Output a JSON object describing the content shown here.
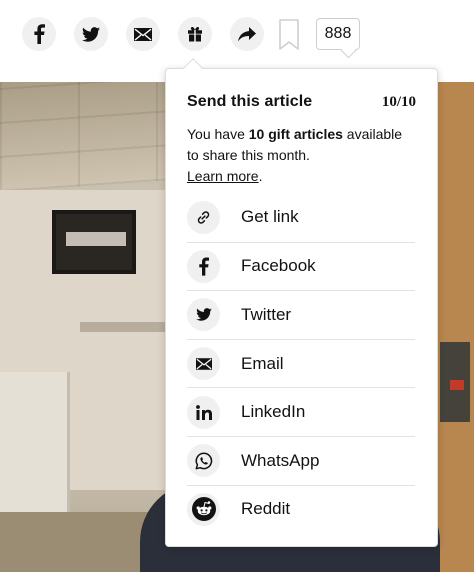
{
  "toolbar": {
    "comment_count": "888",
    "buttons": [
      {
        "name": "facebook-share-button",
        "icon": "facebook-icon"
      },
      {
        "name": "twitter-share-button",
        "icon": "twitter-icon"
      },
      {
        "name": "email-share-button",
        "icon": "mail-icon"
      },
      {
        "name": "gift-article-button",
        "icon": "gift-icon"
      },
      {
        "name": "more-share-button",
        "icon": "share-arrow-icon"
      }
    ],
    "bookmark_icon": "bookmark-icon"
  },
  "popover": {
    "title": "Send this article",
    "count": "10/10",
    "desc_prefix": "You have ",
    "desc_bold": "10 gift articles",
    "desc_suffix": " available to share this month.",
    "learn_more": "Learn more",
    "learn_more_suffix": ".",
    "items": [
      {
        "label": "Get link",
        "icon": "link-icon"
      },
      {
        "label": "Facebook",
        "icon": "facebook-icon"
      },
      {
        "label": "Twitter",
        "icon": "twitter-icon"
      },
      {
        "label": "Email",
        "icon": "mail-icon"
      },
      {
        "label": "LinkedIn",
        "icon": "linkedin-icon"
      },
      {
        "label": "WhatsApp",
        "icon": "whatsapp-icon"
      },
      {
        "label": "Reddit",
        "icon": "reddit-icon"
      }
    ]
  },
  "colors": {
    "text": "#121212",
    "icon_bg": "#f0f0f0",
    "divider": "#e2e2e2"
  }
}
